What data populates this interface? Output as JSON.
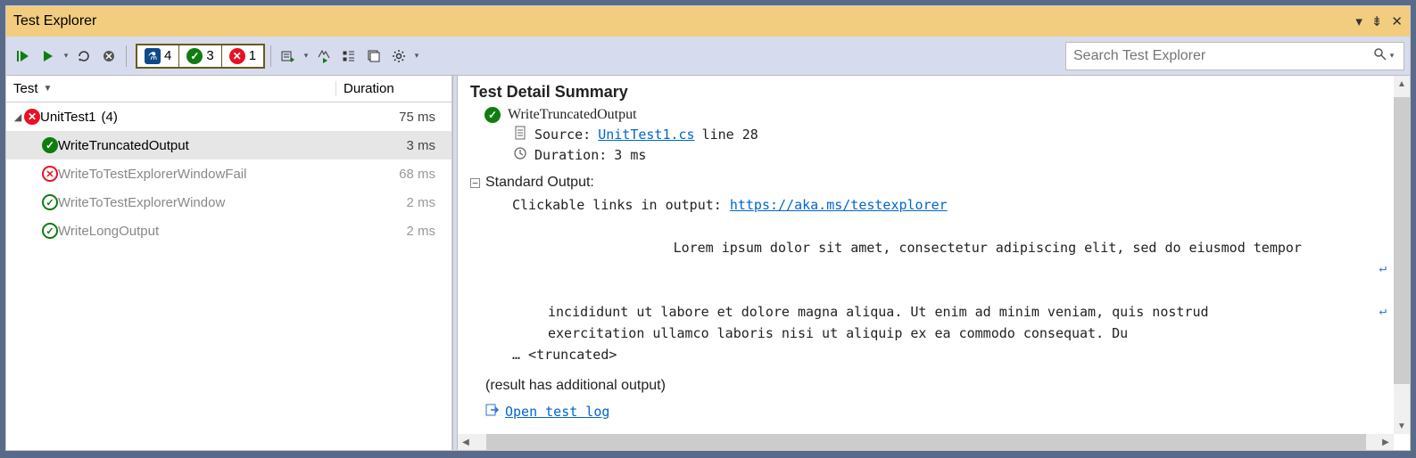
{
  "window": {
    "title": "Test Explorer"
  },
  "search": {
    "placeholder": "Search Test Explorer"
  },
  "counts": {
    "total": "4",
    "passed": "3",
    "failed": "1"
  },
  "columns": {
    "test": "Test",
    "duration": "Duration"
  },
  "tree": {
    "root": {
      "name": "UnitTest1",
      "count_suffix": "(4)",
      "duration": "75 ms"
    },
    "items": [
      {
        "name": "WriteTruncatedOutput",
        "duration": "3 ms",
        "status": "pass",
        "selected": true
      },
      {
        "name": "WriteToTestExplorerWindowFail",
        "duration": "68 ms",
        "status": "fail-o",
        "selected": false
      },
      {
        "name": "WriteToTestExplorerWindow",
        "duration": "2 ms",
        "status": "pass-o",
        "selected": false
      },
      {
        "name": "WriteLongOutput",
        "duration": "2 ms",
        "status": "pass-o",
        "selected": false
      }
    ]
  },
  "detail": {
    "title": "Test Detail Summary",
    "test_name": "WriteTruncatedOutput",
    "source_label": "Source:",
    "source_file": "UnitTest1.cs",
    "source_line": "line 28",
    "duration_label": "Duration:",
    "duration_value": "3 ms",
    "stdout_label": "Standard Output:",
    "stdout_line0": "Clickable links in output:",
    "stdout_link": "https://aka.ms/testexplorer",
    "stdout_line1": "Lorem ipsum dolor sit amet, consectetur adipiscing elit, sed do eiusmod tempor",
    "stdout_line2": "incididunt ut labore et dolore magna aliqua. Ut enim ad minim veniam, quis nostrud",
    "stdout_line3": "exercitation ullamco laboris nisi ut aliquip ex ea commodo consequat. Du",
    "truncated": "… <truncated>",
    "additional": "(result has additional output)",
    "open_log": "Open test log"
  }
}
